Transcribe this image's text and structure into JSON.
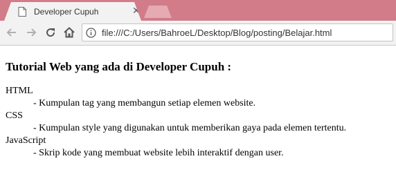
{
  "browser": {
    "tab": {
      "title": "Developer Cupuh",
      "close_icon": "close-icon",
      "favicon": "page-icon"
    },
    "toolbar": {
      "back_icon": "arrow-left-icon",
      "forward_icon": "arrow-right-icon",
      "reload_icon": "reload-icon",
      "home_icon": "home-icon",
      "address": "file:///C:/Users/BahroeL/Desktop/Blog/posting/Belajar.html"
    },
    "colors": {
      "tabstrip": "#d17c88",
      "toolbar": "#f2f2f2"
    }
  },
  "page": {
    "heading": "Tutorial Web yang ada di Developer Cupuh :",
    "items": [
      {
        "term": "HTML",
        "desc": "- Kumpulan tag yang membangun setiap elemen website."
      },
      {
        "term": "CSS",
        "desc": "- Kumpulan style yang digunakan untuk memberikan gaya pada elemen tertentu."
      },
      {
        "term": "JavaScript",
        "desc": "- Skrip kode yang membuat website lebih interaktif dengan user."
      }
    ]
  }
}
